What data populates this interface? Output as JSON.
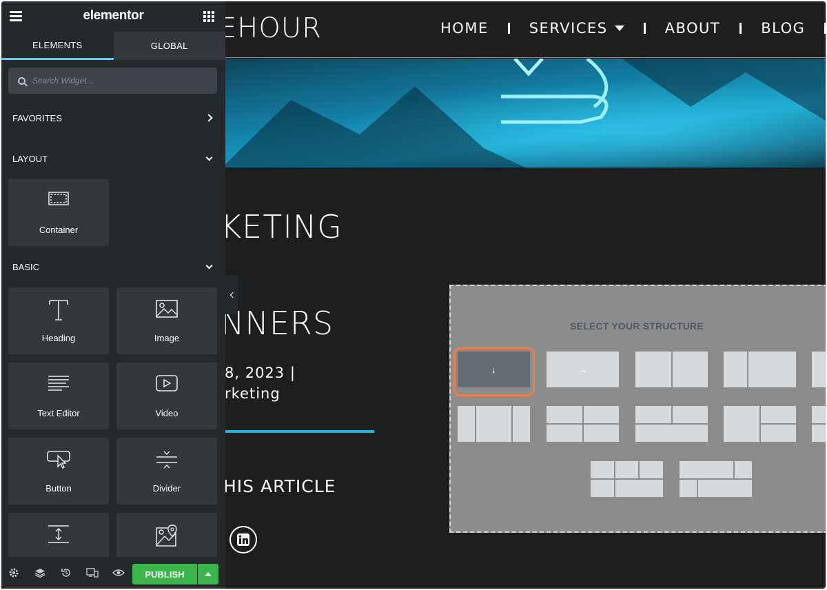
{
  "panel": {
    "brand": "elementor",
    "tabs": [
      {
        "label": "ELEMENTS",
        "active": true
      },
      {
        "label": "GLOBAL",
        "active": false
      }
    ],
    "search": {
      "placeholder": "Search Widget...",
      "value": ""
    },
    "sections": {
      "favorites": "FAVORITES",
      "layout": "LAYOUT",
      "basic": "BASIC"
    },
    "layout_widgets": [
      {
        "label": "Container",
        "icon": "container-icon"
      }
    ],
    "basic_widgets": [
      {
        "label": "Heading",
        "icon": "heading-icon"
      },
      {
        "label": "Image",
        "icon": "image-icon"
      },
      {
        "label": "Text Editor",
        "icon": "text-editor-icon"
      },
      {
        "label": "Video",
        "icon": "video-icon"
      },
      {
        "label": "Button",
        "icon": "button-icon"
      },
      {
        "label": "Divider",
        "icon": "divider-icon"
      },
      {
        "label": "",
        "icon": "spacer-icon"
      },
      {
        "label": "",
        "icon": "google-maps-icon"
      }
    ],
    "footer": {
      "icons": [
        "settings-icon",
        "navigator-layers-icon",
        "history-icon",
        "responsive-mode-icon",
        "preview-eye-icon"
      ],
      "publish_label": "PUBLISH"
    },
    "colors": {
      "panel_bg": "#26292c",
      "widget_bg": "#34383c",
      "accent": "#6ec3e6",
      "publish": "#39b54a"
    }
  },
  "site": {
    "logo_partial": "EHOUR",
    "nav": [
      {
        "label": "HOME",
        "has_dropdown": false
      },
      {
        "label": "SERVICES",
        "has_dropdown": true
      },
      {
        "label": "ABOUT",
        "has_dropdown": false
      },
      {
        "label": "BLOG",
        "has_dropdown": false
      }
    ],
    "post": {
      "title_line_1": "KETING",
      "title_line_2": "NNERS",
      "date": "8, 2023 |",
      "category": "rketing",
      "share_heading": "HIS ARTICLE",
      "social_icon": "linkedin-icon"
    },
    "colors": {
      "bg": "#1e1e1e",
      "accent_line": "#29b7d9"
    }
  },
  "structure_picker": {
    "title": "SELECT YOUR STRUCTURE",
    "selected": "flex-column",
    "highlight_color": "#f07b45"
  }
}
